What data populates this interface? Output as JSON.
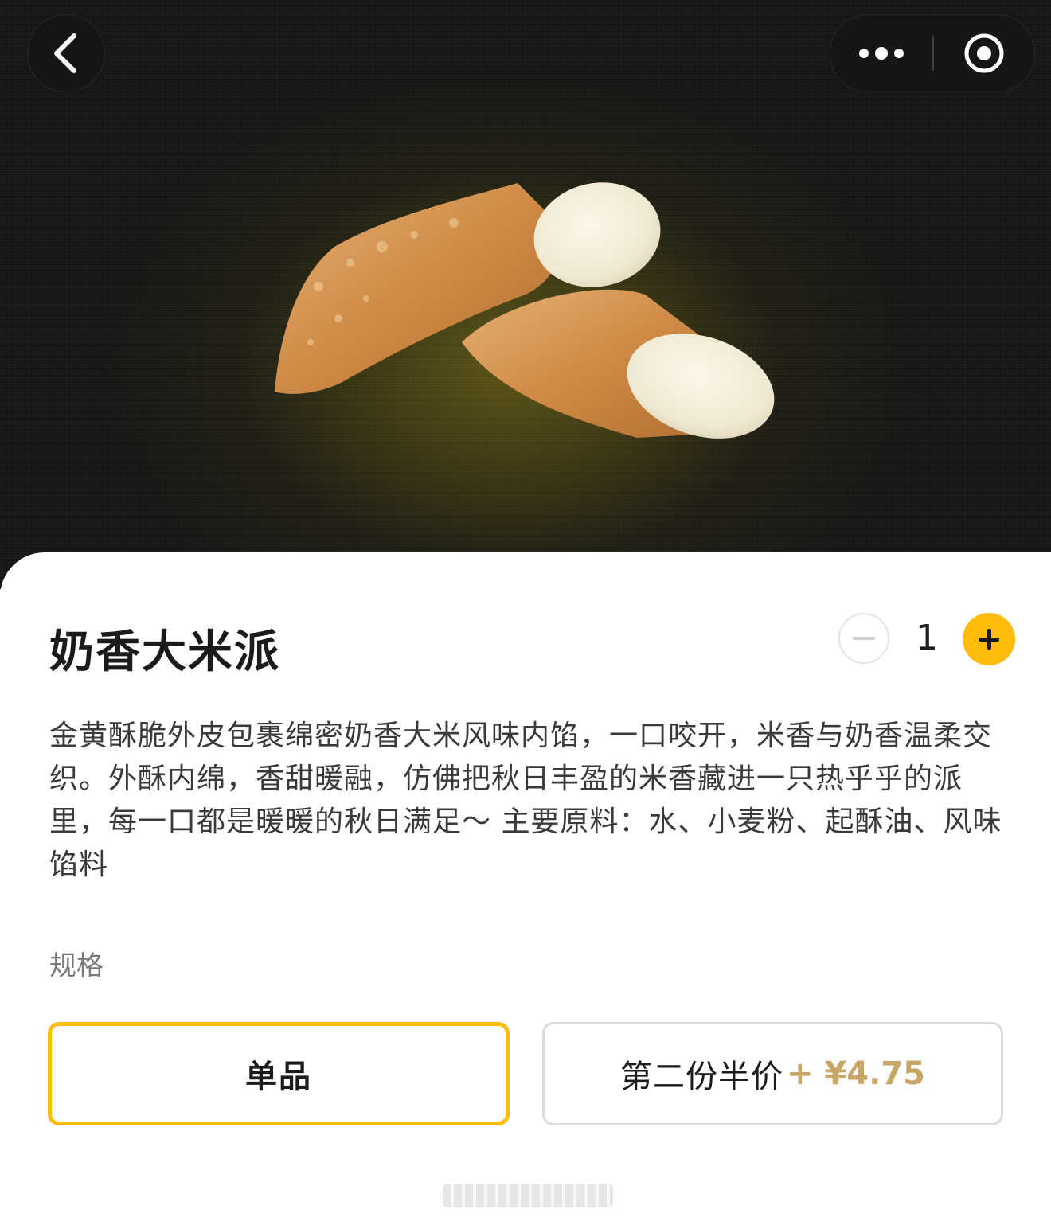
{
  "header": {
    "back_icon": "chevron-left-icon",
    "more_icon": "more-dots-icon",
    "close_icon": "target-circle-icon"
  },
  "product": {
    "image": "apple-pie-photo",
    "title": "奶香大米派",
    "quantity": "1",
    "description": "金黄酥脆外皮包裹绵密奶香大米风味内馅，一口咬开，米香与奶香温柔交织。外酥内绵，香甜暖融，仿佛把秋日丰盈的米香藏进一只热乎乎的派里，每一口都是暖暖的秋日满足～ 主要原料：水、小麦粉、起酥油、风味馅料"
  },
  "spec": {
    "label": "规格",
    "options": [
      {
        "label": "单品",
        "selected": true
      },
      {
        "label": "第二份半价",
        "extra_price": "+ ¥4.75",
        "selected": false
      }
    ]
  },
  "colors": {
    "accent": "#ffbc0d",
    "price": "#c7a668",
    "hero_bg": "#1e1d14"
  }
}
